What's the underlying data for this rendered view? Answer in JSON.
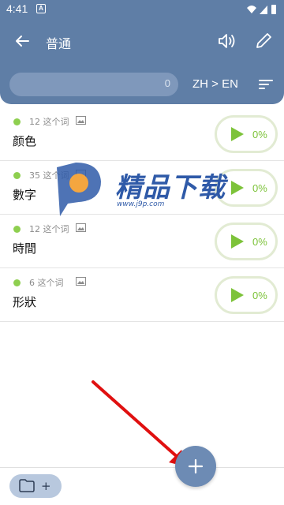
{
  "status_bar": {
    "time": "4:41",
    "app_badge": "A"
  },
  "header": {
    "title": "普通",
    "search_count": "0",
    "language_pair": "ZH > EN"
  },
  "lists": [
    {
      "meta": "12 这个词",
      "name": "颜色",
      "progress": "0%"
    },
    {
      "meta": "35 这个词",
      "name": "數字",
      "progress": "0%"
    },
    {
      "meta": "12 这个词",
      "name": "時間",
      "progress": "0%"
    },
    {
      "meta": "6 这个词",
      "name": "形狀",
      "progress": "0%"
    }
  ],
  "watermark": {
    "brand": "精品下载",
    "url": "www.j9p.com"
  },
  "bottom": {
    "folder_plus": "+"
  },
  "colors": {
    "primary": "#5f7ea6",
    "accent_green": "#7dc33a",
    "fab": "#6d8bb4",
    "arrow": "#e01010"
  },
  "icons": [
    "back-arrow-icon",
    "speaker-icon",
    "pencil-icon",
    "sort-icon",
    "image-icon",
    "play-icon",
    "folder-icon",
    "plus-icon"
  ]
}
